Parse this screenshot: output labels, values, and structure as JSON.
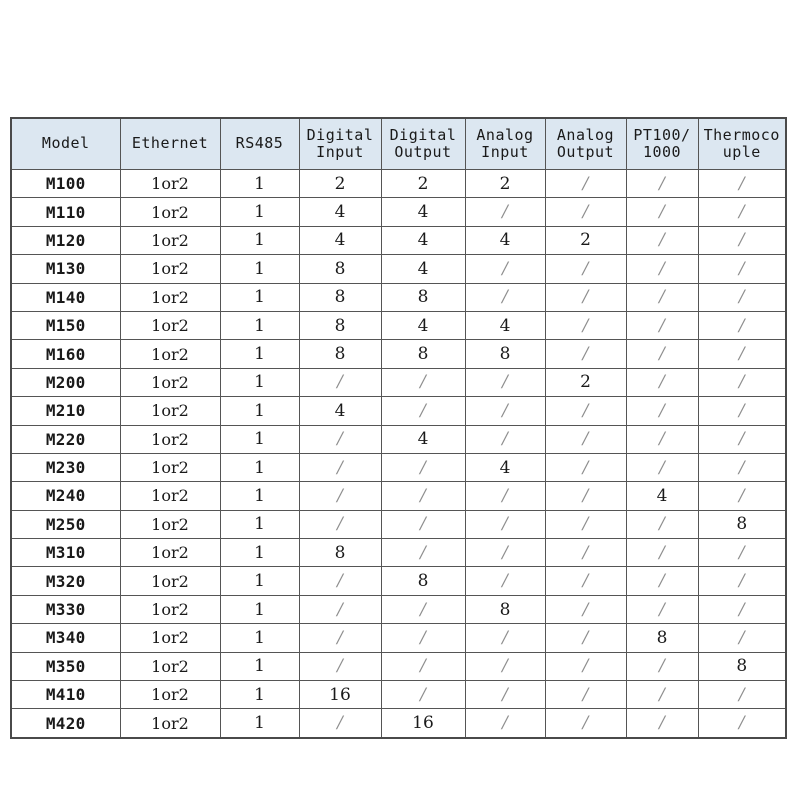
{
  "table": {
    "headers": [
      {
        "name": "model",
        "lines": [
          "Model"
        ]
      },
      {
        "name": "ethernet",
        "lines": [
          "Ethernet"
        ]
      },
      {
        "name": "rs485",
        "lines": [
          "RS485"
        ]
      },
      {
        "name": "digital-input",
        "lines": [
          "Digital",
          "Input"
        ]
      },
      {
        "name": "digital-output",
        "lines": [
          "Digital",
          "Output"
        ]
      },
      {
        "name": "analog-input",
        "lines": [
          "Analog",
          "Input"
        ]
      },
      {
        "name": "analog-output",
        "lines": [
          "Analog",
          "Output"
        ]
      },
      {
        "name": "pt100-1000",
        "lines": [
          "PT100/",
          "1000"
        ]
      },
      {
        "name": "thermocouple",
        "lines": [
          "Thermoco",
          "uple"
        ]
      }
    ],
    "header_bg": "#dce7f1",
    "border_color": "#555555",
    "empty_marker": "/",
    "rows": [
      {
        "model": "M100",
        "ethernet": "1or2",
        "rs485": "1",
        "digital_input": "2",
        "digital_output": "2",
        "analog_input": "2",
        "analog_output": "/",
        "pt100_1000": "/",
        "thermocouple": "/"
      },
      {
        "model": "M110",
        "ethernet": "1or2",
        "rs485": "1",
        "digital_input": "4",
        "digital_output": "4",
        "analog_input": "/",
        "analog_output": "/",
        "pt100_1000": "/",
        "thermocouple": "/"
      },
      {
        "model": "M120",
        "ethernet": "1or2",
        "rs485": "1",
        "digital_input": "4",
        "digital_output": "4",
        "analog_input": "4",
        "analog_output": "2",
        "pt100_1000": "/",
        "thermocouple": "/"
      },
      {
        "model": "M130",
        "ethernet": "1or2",
        "rs485": "1",
        "digital_input": "8",
        "digital_output": "4",
        "analog_input": "/",
        "analog_output": "/",
        "pt100_1000": "/",
        "thermocouple": "/"
      },
      {
        "model": "M140",
        "ethernet": "1or2",
        "rs485": "1",
        "digital_input": "8",
        "digital_output": "8",
        "analog_input": "/",
        "analog_output": "/",
        "pt100_1000": "/",
        "thermocouple": "/"
      },
      {
        "model": "M150",
        "ethernet": "1or2",
        "rs485": "1",
        "digital_input": "8",
        "digital_output": "4",
        "analog_input": "4",
        "analog_output": "/",
        "pt100_1000": "/",
        "thermocouple": "/"
      },
      {
        "model": "M160",
        "ethernet": "1or2",
        "rs485": "1",
        "digital_input": "8",
        "digital_output": "8",
        "analog_input": "8",
        "analog_output": "/",
        "pt100_1000": "/",
        "thermocouple": "/"
      },
      {
        "model": "M200",
        "ethernet": "1or2",
        "rs485": "1",
        "digital_input": "/",
        "digital_output": "/",
        "analog_input": "/",
        "analog_output": "2",
        "pt100_1000": "/",
        "thermocouple": "/"
      },
      {
        "model": "M210",
        "ethernet": "1or2",
        "rs485": "1",
        "digital_input": "4",
        "digital_output": "/",
        "analog_input": "/",
        "analog_output": "/",
        "pt100_1000": "/",
        "thermocouple": "/"
      },
      {
        "model": "M220",
        "ethernet": "1or2",
        "rs485": "1",
        "digital_input": "/",
        "digital_output": "4",
        "analog_input": "/",
        "analog_output": "/",
        "pt100_1000": "/",
        "thermocouple": "/"
      },
      {
        "model": "M230",
        "ethernet": "1or2",
        "rs485": "1",
        "digital_input": "/",
        "digital_output": "/",
        "analog_input": "4",
        "analog_output": "/",
        "pt100_1000": "/",
        "thermocouple": "/"
      },
      {
        "model": "M240",
        "ethernet": "1or2",
        "rs485": "1",
        "digital_input": "/",
        "digital_output": "/",
        "analog_input": "/",
        "analog_output": "/",
        "pt100_1000": "4",
        "thermocouple": "/"
      },
      {
        "model": "M250",
        "ethernet": "1or2",
        "rs485": "1",
        "digital_input": "/",
        "digital_output": "/",
        "analog_input": "/",
        "analog_output": "/",
        "pt100_1000": "/",
        "thermocouple": "8"
      },
      {
        "model": "M310",
        "ethernet": "1or2",
        "rs485": "1",
        "digital_input": "8",
        "digital_output": "/",
        "analog_input": "/",
        "analog_output": "/",
        "pt100_1000": "/",
        "thermocouple": "/"
      },
      {
        "model": "M320",
        "ethernet": "1or2",
        "rs485": "1",
        "digital_input": "/",
        "digital_output": "8",
        "analog_input": "/",
        "analog_output": "/",
        "pt100_1000": "/",
        "thermocouple": "/"
      },
      {
        "model": "M330",
        "ethernet": "1or2",
        "rs485": "1",
        "digital_input": "/",
        "digital_output": "/",
        "analog_input": "8",
        "analog_output": "/",
        "pt100_1000": "/",
        "thermocouple": "/"
      },
      {
        "model": "M340",
        "ethernet": "1or2",
        "rs485": "1",
        "digital_input": "/",
        "digital_output": "/",
        "analog_input": "/",
        "analog_output": "/",
        "pt100_1000": "8",
        "thermocouple": "/"
      },
      {
        "model": "M350",
        "ethernet": "1or2",
        "rs485": "1",
        "digital_input": "/",
        "digital_output": "/",
        "analog_input": "/",
        "analog_output": "/",
        "pt100_1000": "/",
        "thermocouple": "8"
      },
      {
        "model": "M410",
        "ethernet": "1or2",
        "rs485": "1",
        "digital_input": "16",
        "digital_output": "/",
        "analog_input": "/",
        "analog_output": "/",
        "pt100_1000": "/",
        "thermocouple": "/"
      },
      {
        "model": "M420",
        "ethernet": "1or2",
        "rs485": "1",
        "digital_input": "/",
        "digital_output": "16",
        "analog_input": "/",
        "analog_output": "/",
        "pt100_1000": "/",
        "thermocouple": "/"
      }
    ]
  }
}
